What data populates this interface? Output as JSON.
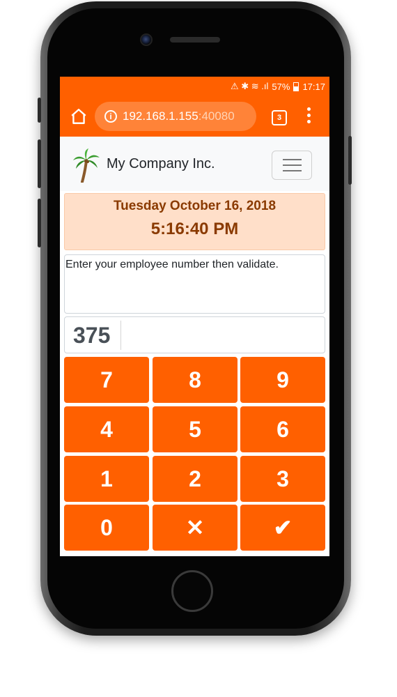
{
  "status_bar": {
    "indicators": "⚠ ✱ ≋ .ıl",
    "battery": "57%",
    "time": "17:17"
  },
  "browser": {
    "url_host": "192.168.1.155",
    "url_port": ":40080",
    "tab_count": "3",
    "icons": [
      "home-icon",
      "info-icon",
      "tabs-icon",
      "more-vert-icon"
    ]
  },
  "navbar": {
    "brand": "My Company Inc.",
    "logo_icon": "palm-tree-icon",
    "toggler_icon": "hamburger-menu-icon"
  },
  "clock": {
    "date": "Tuesday October 16, 2018",
    "time": "5:16:40 PM"
  },
  "message": "Enter your employee number then validate.",
  "entry": {
    "value": "375"
  },
  "keypad": {
    "keys": [
      "7",
      "8",
      "9",
      "4",
      "5",
      "6",
      "1",
      "2",
      "3",
      "0",
      "✕",
      "✔"
    ]
  },
  "colors": {
    "accent": "#ff6000",
    "date_panel_bg": "#ffdfc9",
    "date_text": "#8a3a00"
  }
}
